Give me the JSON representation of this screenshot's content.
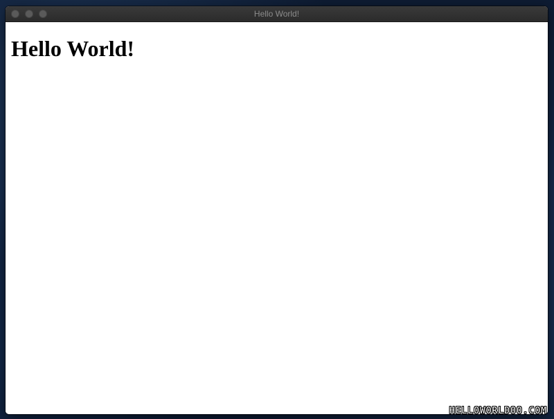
{
  "window": {
    "title": "Hello World!"
  },
  "page": {
    "heading": "Hello World!"
  },
  "watermark": {
    "text": "HELLOWORLDOO.COM"
  },
  "colors": {
    "titlebar": "#2b2b2b",
    "title_text": "#8c8c8c",
    "traffic_lights": "#5a5a5a",
    "content_background": "#ffffff",
    "heading_text": "#000000"
  },
  "icons": {
    "traffic_lights": [
      "close-icon",
      "minimize-icon",
      "zoom-icon"
    ]
  }
}
